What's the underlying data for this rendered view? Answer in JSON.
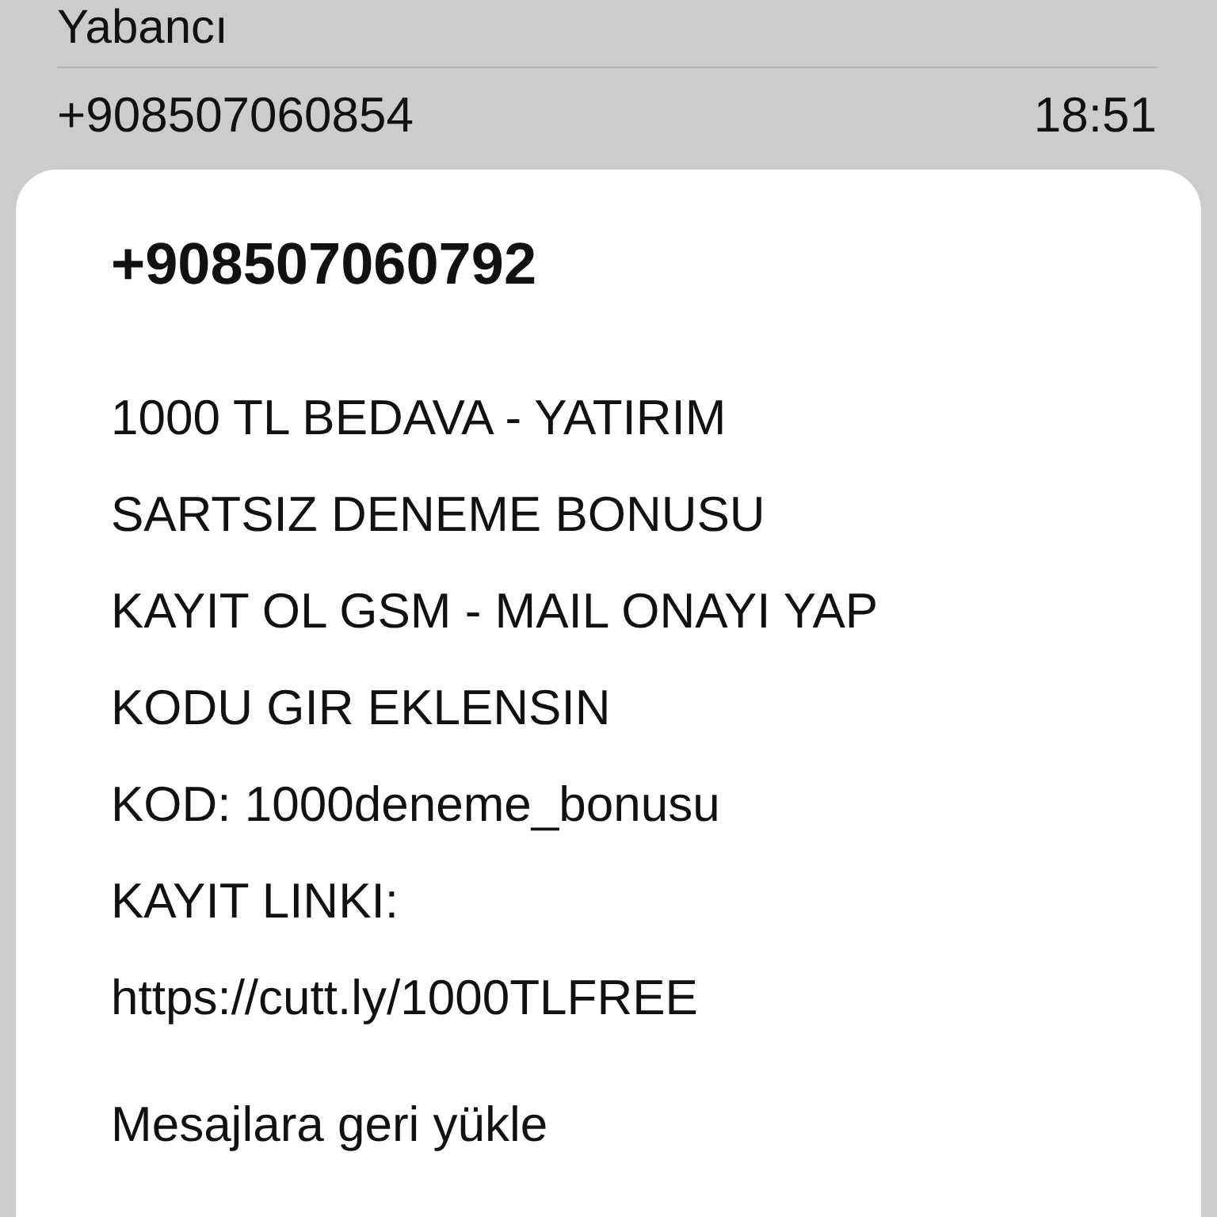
{
  "list": {
    "previous_sender": "Yabancı",
    "row": {
      "sender": "+908507060854",
      "time": "18:51"
    }
  },
  "sheet": {
    "sender": "+908507060792",
    "message_lines": [
      "1000 TL BEDAVA - YATIRIM",
      "SARTSIZ DENEME BONUSU",
      "KAYIT OL GSM - MAIL ONAYI YAP",
      "KODU GIR EKLENSIN",
      "KOD: 1000deneme_bonusu",
      "KAYIT LINKI:",
      "https://cutt.ly/1000TLFREE"
    ],
    "action": "Mesajlara geri yükle"
  }
}
